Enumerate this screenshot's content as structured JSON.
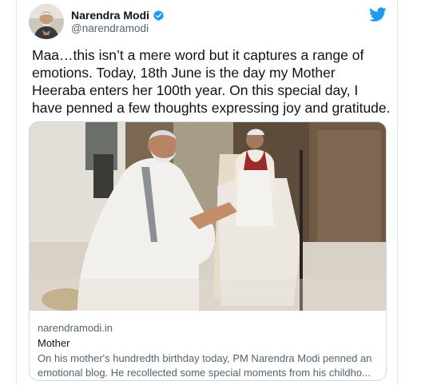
{
  "tweet": {
    "author": {
      "display_name": "Narendra Modi",
      "handle": "@narendramodi",
      "verified": true,
      "avatar_icon": "profile-photo"
    },
    "brand_icon": "twitter-bird-icon",
    "brand_color": "#1d9bf0",
    "text": "Maa…this isn’t a mere word but it captures a range of emotions. Today, 18th June is the day my Mother Heeraba enters her 100th year. On this special day, I have penned a few thoughts expressing joy and gratitude.",
    "link_card": {
      "image": "photo-modi-with-mother",
      "domain": "narendramodi.in",
      "title": "Mother",
      "description": "On his mother's hundredth birthday today, PM Narendra Modi penned an emotional blog. He recollected some special moments from his childho..."
    }
  }
}
